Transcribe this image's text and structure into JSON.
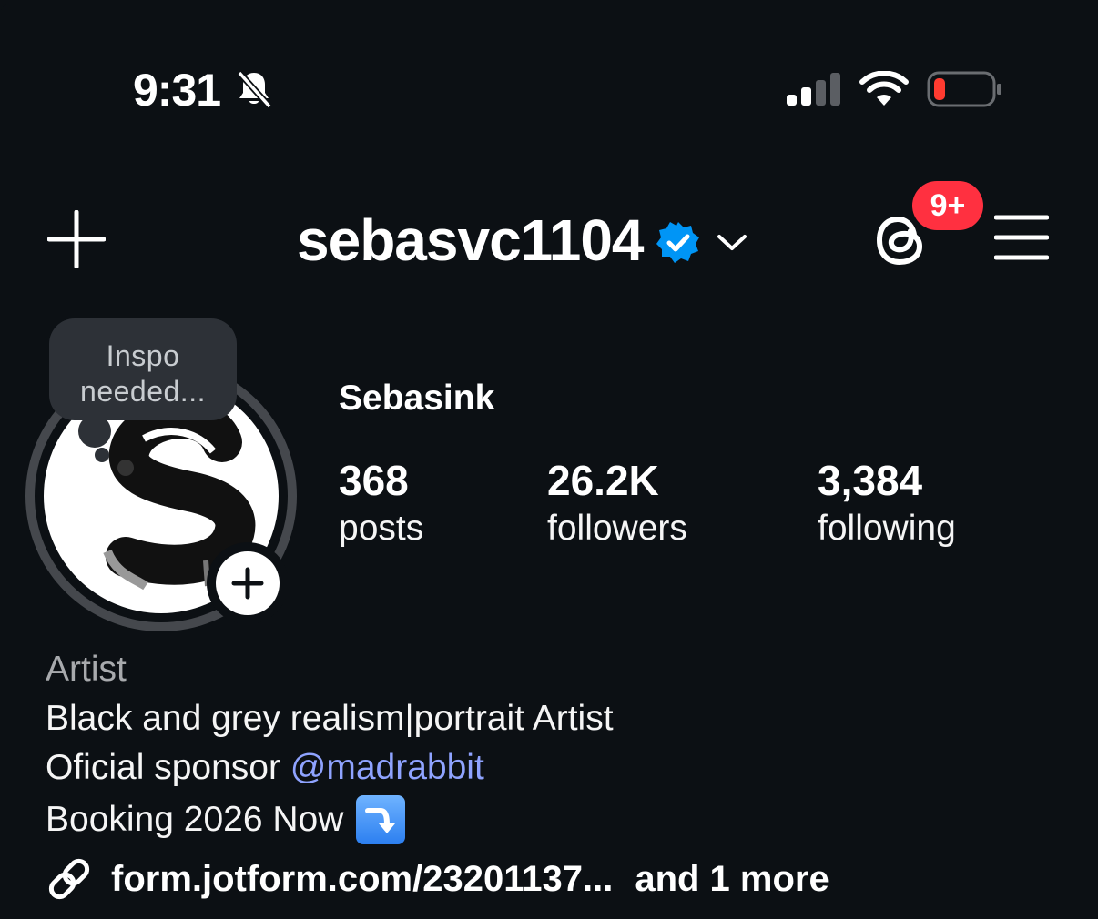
{
  "status_bar": {
    "time": "9:31",
    "icons": [
      "bell-slash-icon",
      "cellular-signal-icon",
      "wifi-icon",
      "battery-low-icon"
    ]
  },
  "header": {
    "username": "sebasvc1104",
    "verified": true,
    "threads_badge": "9+",
    "icons": [
      "plus-icon",
      "verified-badge-icon",
      "chevron-down-icon",
      "threads-icon",
      "hamburger-menu-icon"
    ]
  },
  "note": {
    "text": "Inspo needed..."
  },
  "profile": {
    "display_name": "Sebasink",
    "stats": [
      {
        "value": "368",
        "label": "posts"
      },
      {
        "value": "26.2K",
        "label": "followers"
      },
      {
        "value": "3,384",
        "label": "following"
      }
    ]
  },
  "bio": {
    "category": "Artist",
    "line1": "Black and grey realism|portrait Artist",
    "line2_prefix": "Oficial sponsor ",
    "line2_mention": "@madrabbit",
    "line3": "Booking 2026 Now",
    "line3_emoji": "right-arrow-curving-down-icon"
  },
  "link": {
    "url": "form.jotform.com/23201137...",
    "more": "and 1 more"
  },
  "colors": {
    "background": "#0c1014",
    "verified_blue": "#0095f6",
    "badge_red": "#ff3040",
    "mention_blue": "#8fa3ff",
    "muted": "#a8aaad"
  }
}
